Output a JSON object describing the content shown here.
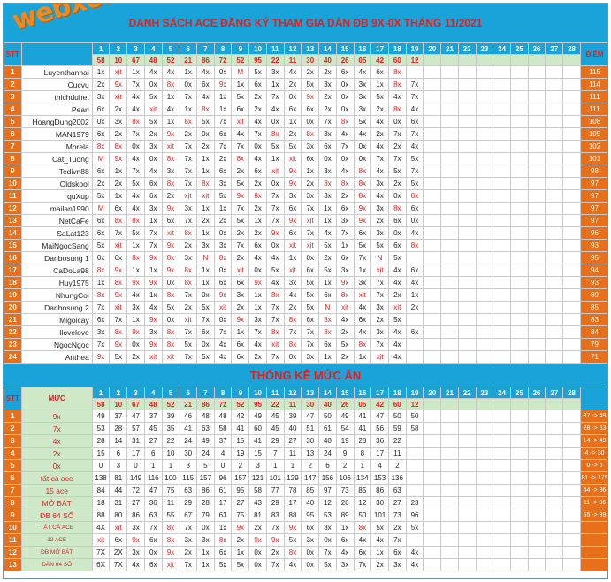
{
  "title": "DANH SÁCH ACE ĐĂNG KÝ THAM GIA DÀN ĐB 9X-0X THÁNG 11/2021",
  "watermark": "webxoso.net",
  "stt_label": "STT",
  "points_label": "ĐIỂM",
  "stats_title": "THỐNG KÊ MỨC ĂN",
  "level_label": "MỨC",
  "days": [
    "1",
    "2",
    "3",
    "4",
    "5",
    "6",
    "7",
    "8",
    "9",
    "10",
    "11",
    "12",
    "13",
    "14",
    "15",
    "16",
    "17",
    "18",
    "19",
    "20",
    "21",
    "22",
    "23",
    "24",
    "25",
    "26",
    "27",
    "28"
  ],
  "results": [
    "58",
    "10",
    "67",
    "48",
    "52",
    "21",
    "86",
    "72",
    "52",
    "95",
    "22",
    "11",
    "30",
    "40",
    "26",
    "05",
    "42",
    "60",
    "12",
    "",
    "",
    "",
    "",
    "",
    "",
    "",
    "",
    ""
  ],
  "players": [
    {
      "n": "1",
      "name": "Luyenthanhai",
      "pts": "115",
      "c": [
        "1x",
        "x|t",
        "1x",
        "4x",
        "4x",
        "1x",
        "4x",
        "0x",
        "M",
        "5x",
        "3x",
        "4x",
        "2x",
        "2x",
        "6x",
        "4x",
        "6x",
        "8x"
      ]
    },
    {
      "n": "2",
      "name": "Cucvu",
      "pts": "114",
      "c": [
        "2x",
        "9x",
        "7x",
        "0x",
        "8x",
        "0x",
        "6x",
        "9x",
        "1x",
        "6x",
        "1x",
        "2x",
        "5x",
        "3x",
        "0x",
        "3x",
        "1x",
        "8x",
        "7x"
      ]
    },
    {
      "n": "3",
      "name": "thichduhet",
      "pts": "111",
      "c": [
        "3x",
        "x|t",
        "4x",
        "5x",
        "1x",
        "7x",
        "4x",
        "1x",
        "5x",
        "2x",
        "7x",
        "0x",
        "9x",
        "2x",
        "0x",
        "3x",
        "5x",
        "4x",
        "7x"
      ]
    },
    {
      "n": "4",
      "name": "Pearl",
      "pts": "111",
      "c": [
        "6x",
        "2x",
        "4x",
        "x|t",
        "4x",
        "1x",
        "8x",
        "1x",
        "6x",
        "2x",
        "4x",
        "6x",
        "6x",
        "2x",
        "0x",
        "3x",
        "2x",
        "8x",
        "4x"
      ]
    },
    {
      "n": "5",
      "name": "HoangDung2002",
      "pts": "108",
      "c": [
        "0x",
        "3x",
        "8x",
        "5x",
        "1x",
        "8x",
        "5x",
        "7x",
        "x|t",
        "4x",
        "0x",
        "1x",
        "0x",
        "7x",
        "8x",
        "5x",
        "4x",
        "0x",
        "6x"
      ]
    },
    {
      "n": "6",
      "name": "MAN1979",
      "pts": "105",
      "c": [
        "6x",
        "2x",
        "7x",
        "2x",
        "9x",
        "2x",
        "0x",
        "6x",
        "4x",
        "7x",
        "8x",
        "2x",
        "8x",
        "3x",
        "4x",
        "4x",
        "2x",
        "7x",
        "7x"
      ]
    },
    {
      "n": "7",
      "name": "Morela",
      "pts": "102",
      "c": [
        "8x",
        "8x",
        "0x",
        "3x",
        "x|t",
        "7x",
        "2x",
        "7x",
        "7x",
        "0x",
        "5x",
        "5x",
        "3x",
        "6x",
        "7x",
        "0x",
        "4x",
        "2x",
        "4x"
      ]
    },
    {
      "n": "8",
      "name": "Cat_Tuong",
      "pts": "101",
      "c": [
        "M",
        "9x",
        "4x",
        "0x",
        "8x",
        "7x",
        "1x",
        "2x",
        "8x",
        "4x",
        "1x",
        "x|t",
        "6x",
        "0x",
        "0x",
        "0x",
        "7x",
        "7x",
        "5x"
      ]
    },
    {
      "n": "9",
      "name": "Tedivn88",
      "pts": "98",
      "c": [
        "6x",
        "1x",
        "7x",
        "4x",
        "3x",
        "7x",
        "1x",
        "6x",
        "2x",
        "6x",
        "x|t",
        "9x",
        "1x",
        "3x",
        "4x",
        "8x",
        "4x",
        "5x",
        "7x"
      ]
    },
    {
      "n": "10",
      "name": "Oldskool",
      "pts": "97",
      "c": [
        "2x",
        "2x",
        "5x",
        "6x",
        "8x",
        "7x",
        "8x",
        "3x",
        "5x",
        "2x",
        "0x",
        "9x",
        "2x",
        "8x",
        "8x",
        "8x",
        "3x",
        "2x",
        "5x"
      ]
    },
    {
      "n": "11",
      "name": "quXup",
      "pts": "97",
      "c": [
        "5x",
        "1x",
        "4x",
        "6x",
        "2x",
        "x|t",
        "x|t",
        "5x",
        "9x",
        "8x",
        "7x",
        "3x",
        "3x",
        "3x",
        "2x",
        "8x",
        "4x",
        "0x",
        "8x"
      ]
    },
    {
      "n": "12",
      "name": "mailan1990",
      "pts": "97",
      "c": [
        "M",
        "6x",
        "4x",
        "3x",
        "9x",
        "3x",
        "1x",
        "1x",
        "7x",
        "2x",
        "7x",
        "6x",
        "7x",
        "1x",
        "6x",
        "9x",
        "3x",
        "8x",
        "6x"
      ]
    },
    {
      "n": "13",
      "name": "NetCaFe",
      "pts": "97",
      "c": [
        "6x",
        "8x",
        "8x",
        "1x",
        "6x",
        "7x",
        "2x",
        "2x",
        "5x",
        "1x",
        "7x",
        "9x",
        "x|t",
        "1x",
        "3x",
        "9x",
        "2x",
        "6x",
        "0x"
      ]
    },
    {
      "n": "14",
      "name": "SaLat123",
      "pts": "96",
      "c": [
        "6x",
        "7x",
        "5x",
        "7x",
        "x|t",
        "8x",
        "1x",
        "0x",
        "2x",
        "2x",
        "9x",
        "6x",
        "7x",
        "4x",
        "7x",
        "6x",
        "3x",
        "0x",
        "4x"
      ]
    },
    {
      "n": "15",
      "name": "MaiNgocSang",
      "pts": "93",
      "c": [
        "5x",
        "x|t",
        "1x",
        "7x",
        "9x",
        "2x",
        "3x",
        "3x",
        "7x",
        "6x",
        "0x",
        "x|t",
        "x|t",
        "5x",
        "1x",
        "5x",
        "5x",
        "6x",
        "8x"
      ]
    },
    {
      "n": "16",
      "name": "Danbosung 1",
      "pts": "95",
      "c": [
        "0x",
        "6x",
        "8x",
        "9x",
        "8x",
        "3x",
        "N",
        "8x",
        "2x",
        "4x",
        "4x",
        "1x",
        "0x",
        "2x",
        "6x",
        "7x",
        "N",
        "5x"
      ]
    },
    {
      "n": "17",
      "name": "CaDoLa98",
      "pts": "94",
      "c": [
        "8x",
        "9x",
        "1x",
        "1x",
        "9x",
        "8x",
        "1x",
        "0x",
        "x|t",
        "0x",
        "5x",
        "x|t",
        "6x",
        "5x",
        "3x",
        "1x",
        "x|t",
        "4x",
        "6x"
      ]
    },
    {
      "n": "18",
      "name": "Huy1975",
      "pts": "93",
      "c": [
        "1x",
        "8x",
        "9x",
        "9x",
        "0x",
        "8x",
        "1x",
        "6x",
        "6x",
        "9x",
        "4x",
        "3x",
        "5x",
        "1x",
        "9x",
        "3x",
        "7x",
        "4x",
        "4x"
      ]
    },
    {
      "n": "19",
      "name": "NhungCoi",
      "pts": "89",
      "c": [
        "8x",
        "9x",
        "4x",
        "1x",
        "8x",
        "7x",
        "0x",
        "9x",
        "3x",
        "1x",
        "8x",
        "4x",
        "5x",
        "6x",
        "8x",
        "x|t",
        "7x",
        "2x",
        "1x"
      ]
    },
    {
      "n": "20",
      "name": "Danbosung 2",
      "pts": "85",
      "c": [
        "7x",
        "x|t",
        "3x",
        "4x",
        "5x",
        "2x",
        "5x",
        "x|t",
        "2x",
        "1x",
        "7x",
        "2x",
        "5x",
        "N",
        "x|t",
        "4x",
        "3x",
        "x|t",
        "2x"
      ]
    },
    {
      "n": "21",
      "name": "Migoicay",
      "pts": "83",
      "c": [
        "6x",
        "7x",
        "1x",
        "9x",
        "0x",
        "x|t",
        "7x",
        "0x",
        "9x",
        "3x",
        "7x",
        "8x",
        "6x",
        "8x",
        "4x",
        "6x",
        "2x",
        "5x"
      ]
    },
    {
      "n": "22",
      "name": "Ilovelove",
      "pts": "84",
      "c": [
        "3x",
        "8x",
        "9x",
        "3x",
        "8x",
        "7x",
        "6x",
        "7x",
        "1x",
        "7x",
        "8x",
        "7x",
        "7x",
        "8x",
        "2x",
        "4x",
        "3x",
        "4x",
        "6x"
      ]
    },
    {
      "n": "23",
      "name": "NgocNgoc",
      "pts": "79",
      "c": [
        "7x",
        "9x",
        "0x",
        "9x",
        "8x",
        "5x",
        "0x",
        "4x",
        "6x",
        "4x",
        "x|t",
        "8x",
        "7x",
        "6x",
        "5x",
        "8x",
        "7x",
        "4x"
      ]
    },
    {
      "n": "24",
      "name": "Anthea",
      "pts": "71",
      "c": [
        "9x",
        "5x",
        "2x",
        "x|t",
        "x|t",
        "7x",
        "5x",
        "4x",
        "6x",
        "2x",
        "7x",
        "0x",
        "3x",
        "1x",
        "2x",
        "1x",
        "x|t",
        "4x"
      ]
    }
  ],
  "stats": [
    {
      "n": "1",
      "name": "9x",
      "range": "37 -> 49",
      "c": [
        "49",
        "37",
        "47",
        "37",
        "39",
        "46",
        "48",
        "48",
        "42",
        "49",
        "45",
        "39",
        "47",
        "50",
        "49",
        "41",
        "47",
        "50",
        "50"
      ]
    },
    {
      "n": "2",
      "name": "7x",
      "range": "28 -> 63",
      "c": [
        "53",
        "28",
        "57",
        "45",
        "35",
        "41",
        "63",
        "58",
        "41",
        "60",
        "45",
        "40",
        "51",
        "61",
        "54",
        "41",
        "56",
        "59",
        "58"
      ]
    },
    {
      "n": "3",
      "name": "4x",
      "range": "14 -> 49",
      "c": [
        "28",
        "14",
        "31",
        "27",
        "22",
        "24",
        "49",
        "37",
        "15",
        "41",
        "29",
        "27",
        "30",
        "40",
        "19",
        "28",
        "36",
        "22"
      ]
    },
    {
      "n": "4",
      "name": "2x",
      "range": "4 -> 30",
      "c": [
        "15",
        "6",
        "17",
        "6",
        "10",
        "30",
        "24",
        "4",
        "19",
        "15",
        "7",
        "11",
        "13",
        "24",
        "9",
        "8",
        "17",
        "11"
      ]
    },
    {
      "n": "5",
      "name": "0x",
      "range": "0 -> 5",
      "c": [
        "0",
        "3",
        "0",
        "1",
        "1",
        "3",
        "5",
        "0",
        "2",
        "3",
        "1",
        "1",
        "2",
        "6",
        "2",
        "1",
        "4",
        "2"
      ]
    },
    {
      "n": "6",
      "name": "tất cả ace",
      "range": "81 -> 175",
      "c": [
        "138",
        "81",
        "149",
        "116",
        "100",
        "115",
        "157",
        "96",
        "157",
        "121",
        "101",
        "129",
        "147",
        "156",
        "106",
        "134",
        "153",
        "136"
      ]
    },
    {
      "n": "7",
      "name": "15 ace",
      "range": "44 -> 86",
      "c": [
        "84",
        "44",
        "72",
        "47",
        "75",
        "63",
        "86",
        "61",
        "95",
        "58",
        "77",
        "78",
        "85",
        "97",
        "73",
        "85",
        "86",
        "63"
      ]
    },
    {
      "n": "8",
      "name": "MỞ BÁT",
      "range": "11 -> 36",
      "c": [
        "18",
        "31",
        "27",
        "36",
        "11",
        "29",
        "28",
        "17",
        "27",
        "43",
        "29",
        "17",
        "40",
        "12",
        "26",
        "12",
        "30",
        "27",
        "23"
      ]
    },
    {
      "n": "9",
      "name": "ĐB 64 SỐ",
      "range": "55 -> 89",
      "c": [
        "88",
        "80",
        "86",
        "63",
        "55",
        "67",
        "79",
        "63",
        "75",
        "81",
        "83",
        "88",
        "95",
        "53",
        "89",
        "50",
        "101",
        "73",
        "96"
      ]
    },
    {
      "n": "10",
      "name": "TẤT CẢ ACE",
      "small": true,
      "range": "",
      "c": [
        "4X",
        "x|t",
        "3x",
        "7x",
        "8x",
        "7x",
        "0x",
        "1x",
        "9x",
        "2x",
        "7x",
        "9x",
        "6x",
        "3x",
        "1x",
        "8x",
        "5x",
        "2x",
        "5x"
      ]
    },
    {
      "n": "11",
      "name": "12 ACE",
      "small": true,
      "range": "",
      "c": [
        "x|t",
        "6x",
        "9x",
        "6x",
        "8x",
        "3x",
        "3x",
        "8x",
        "2x",
        "9x",
        "9x",
        "5x",
        "3x",
        "0x",
        "6x",
        "4x",
        "4x",
        "7x"
      ]
    },
    {
      "n": "12",
      "name": "ĐB MỞ BÁT",
      "small": true,
      "range": "",
      "c": [
        "7X",
        "2X",
        "3x",
        "0x",
        "9x",
        "2x",
        "1x",
        "6x",
        "1x",
        "0x",
        "2x",
        "8x",
        "0x",
        "7x",
        "4x",
        "6x",
        "1x",
        "6x",
        "4x"
      ]
    },
    {
      "n": "13",
      "name": "DÀN 64 SỐ",
      "small": true,
      "range": "",
      "c": [
        "6X",
        "7X",
        "4x",
        "6x",
        "x|t",
        "7x",
        "1x",
        "5x",
        "5x",
        "0x",
        "7x",
        "4x",
        "0x",
        "5x",
        "3x",
        "7x",
        "2x",
        "3x",
        "4x"
      ]
    }
  ]
}
